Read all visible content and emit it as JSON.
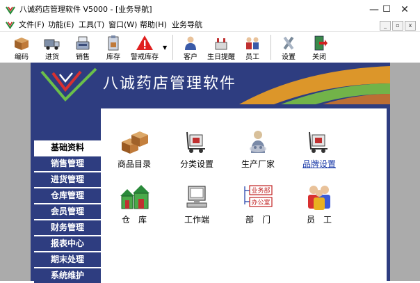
{
  "window": {
    "title": "八诚药店管理软件 V5000 - [业务导航]",
    "controls": {
      "minimize": "—",
      "maximize": "☐",
      "close": "✕"
    }
  },
  "menu": {
    "items": [
      "文件(F)",
      "功能(E)",
      "工具(T)",
      "窗口(W)",
      "帮助(H)",
      "业务导航"
    ],
    "mdi_controls": [
      "_",
      "▫",
      "x"
    ]
  },
  "toolbar": {
    "buttons": [
      {
        "label": "编码",
        "icon": "box-icon"
      },
      {
        "label": "进货",
        "icon": "truck-icon"
      },
      {
        "label": "销售",
        "icon": "cashier-icon"
      },
      {
        "label": "库存",
        "icon": "clipboard-icon"
      },
      {
        "label": "警戒库存",
        "icon": "warning-icon"
      },
      {
        "label": "客户",
        "icon": "customer-icon"
      },
      {
        "label": "生日提醒",
        "icon": "birthday-icon"
      },
      {
        "label": "员工",
        "icon": "staff-icon"
      },
      {
        "label": "设置",
        "icon": "tools-icon"
      },
      {
        "label": "关闭",
        "icon": "exit-door-icon"
      }
    ]
  },
  "banner": {
    "title": "八诚药店管理软件"
  },
  "sidebar": {
    "items": [
      "基础资料",
      "销售管理",
      "进货管理",
      "仓库管理",
      "会员管理",
      "财务管理",
      "报表中心",
      "期末处理",
      "系统维护"
    ],
    "active_index": 0
  },
  "features": [
    {
      "label": "商品目录",
      "icon": "boxes-icon",
      "link": false
    },
    {
      "label": "分类设置",
      "icon": "dolly-icon",
      "link": false
    },
    {
      "label": "生产厂家",
      "icon": "manufacturer-icon",
      "link": false
    },
    {
      "label": "品牌设置",
      "icon": "dolly-icon",
      "link": true
    },
    {
      "label": "仓　库",
      "icon": "warehouse-icon",
      "link": false
    },
    {
      "label": "工作端",
      "icon": "computer-icon",
      "link": false
    },
    {
      "label": "部　门",
      "icon": "org-chart-icon",
      "link": false
    },
    {
      "label": "员　工",
      "icon": "people-icon",
      "link": false
    }
  ],
  "org_chart_text": [
    "业务部",
    "办公室"
  ],
  "colors": {
    "navy": "#2e3d80",
    "link": "#1a3aa8",
    "workspace_gray": "#ababab",
    "warning_red": "#e02020"
  }
}
